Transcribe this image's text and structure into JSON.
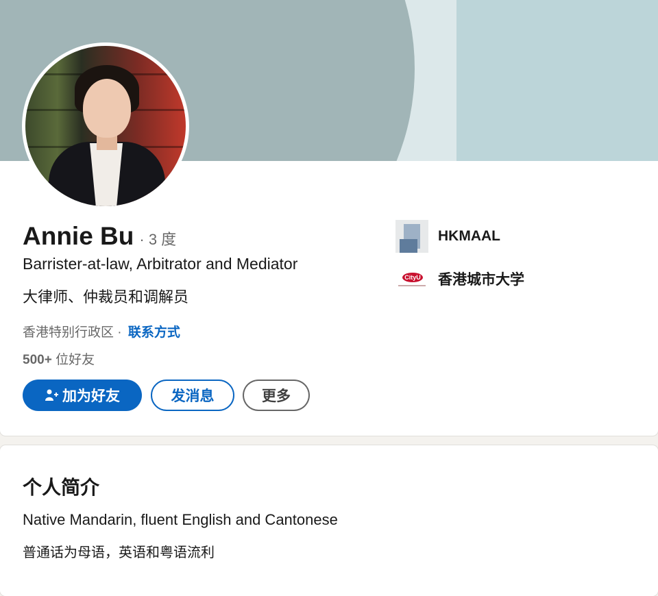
{
  "profile": {
    "name": "Annie Bu",
    "degree": "· 3 度",
    "headline_en": "Barrister-at-law, Arbitrator and Mediator",
    "headline_cn": "大律师、仲裁员和调解员",
    "location": "香港特别行政区",
    "separator": "·",
    "contact_link": "联系方式",
    "connections_count": "500+",
    "connections_label": "位好友"
  },
  "actions": {
    "connect_label": "加为好友",
    "message_label": "发消息",
    "more_label": "更多"
  },
  "organizations": [
    {
      "name": "HKMAAL",
      "icon": "hkmaal-logo"
    },
    {
      "name": "香港城市大学",
      "icon": "cityu-logo",
      "logo_text": "CityU"
    }
  ],
  "about": {
    "title": "个人简介",
    "text_en": "Native Mandarin, fluent English and Cantonese",
    "text_cn": "普通话为母语，英语和粤语流利"
  },
  "colors": {
    "accent": "#0a66c2",
    "banner_dark": "#a1b5b7",
    "banner_light": "#dce8ea",
    "banner_right": "#bcd5d9"
  }
}
